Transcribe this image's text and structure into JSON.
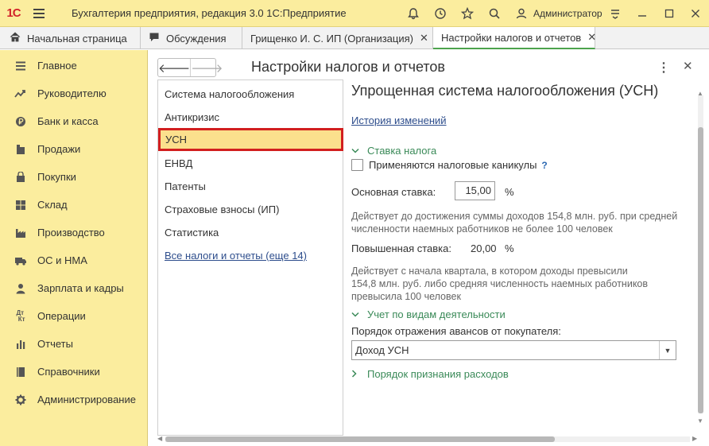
{
  "titlebar": {
    "logo": "1С",
    "app_title": "Бухгалтерия предприятия, редакция 3.0 1С:Предприятие",
    "user": "Администратор",
    "icons": [
      "bell-icon",
      "history-icon",
      "star-icon",
      "search-icon",
      "user-icon"
    ]
  },
  "tabs": [
    {
      "label": "Начальная страница",
      "icon": "home-icon"
    },
    {
      "label": "Обсуждения",
      "icon": "chat-icon"
    },
    {
      "label": "Грищенко И. С. ИП (Организация)",
      "closable": true
    },
    {
      "label": "Настройки налогов и отчетов",
      "closable": true,
      "active": true
    }
  ],
  "sidebar": {
    "items": [
      {
        "label": "Главное",
        "icon": "menu-icon"
      },
      {
        "label": "Руководителю",
        "icon": "trend-icon"
      },
      {
        "label": "Банк и касса",
        "icon": "coin-icon"
      },
      {
        "label": "Продажи",
        "icon": "cart-icon"
      },
      {
        "label": "Покупки",
        "icon": "basket-icon"
      },
      {
        "label": "Склад",
        "icon": "warehouse-icon"
      },
      {
        "label": "Производство",
        "icon": "factory-icon"
      },
      {
        "label": "ОС и НМА",
        "icon": "truck-icon"
      },
      {
        "label": "Зарплата и кадры",
        "icon": "person-icon"
      },
      {
        "label": "Операции",
        "icon": "dtkt-icon"
      },
      {
        "label": "Отчеты",
        "icon": "report-icon"
      },
      {
        "label": "Справочники",
        "icon": "book-icon"
      },
      {
        "label": "Администрирование",
        "icon": "gear-icon"
      }
    ]
  },
  "form": {
    "title": "Настройки налогов и отчетов",
    "list": {
      "items": [
        "Система налогообложения",
        "Антикризис",
        "УСН",
        "ЕНВД",
        "Патенты",
        "Страховые взносы (ИП)",
        "Статистика"
      ],
      "selected": "УСН",
      "more_link": "Все налоги и отчеты (еще 14)"
    },
    "panel": {
      "title": "Упрощенная система налогообложения (УСН)",
      "history_link": "История изменений",
      "group_rate": "Ставка налога",
      "holidays_label": "Применяются налоговые каникулы",
      "help": "?",
      "base_rate_label": "Основная ставка:",
      "base_rate_value": "15,00",
      "percent": "%",
      "base_rate_note_1": "Действует до достижения суммы доходов 154,8 млн. руб. при средней",
      "base_rate_note_2": "численности наемных работников не более 100 человек",
      "high_rate_label": "Повышенная ставка:",
      "high_rate_value": "20,00",
      "high_rate_note_1": "Действует с начала квартала, в котором доходы превысили",
      "high_rate_note_2": "154,8 млн. руб. либо средняя численность наемных работников",
      "high_rate_note_3": "превысила 100 человек",
      "group_activity": "Учет по видам деятельности",
      "advances_label": "Порядок отражения авансов от покупателя:",
      "advances_value": "Доход УСН",
      "group_expenses": "Порядок признания расходов"
    }
  }
}
